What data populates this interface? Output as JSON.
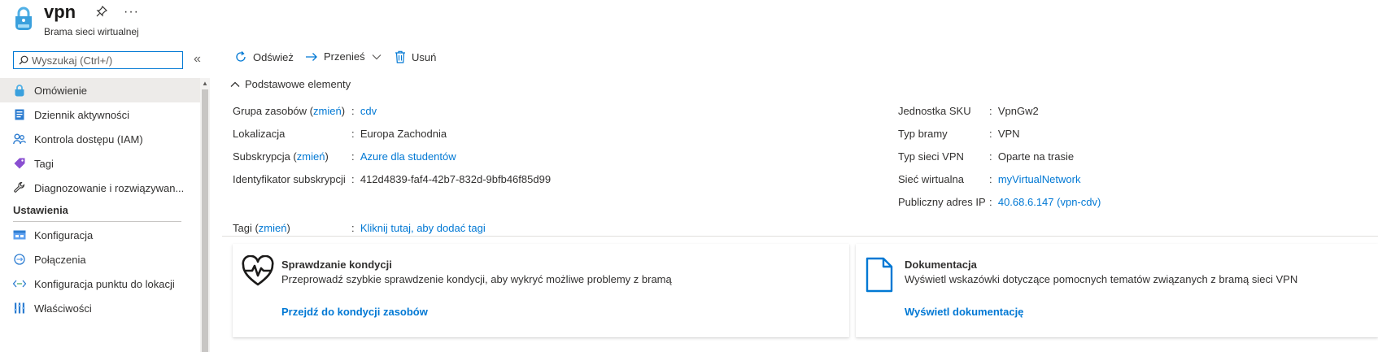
{
  "header": {
    "title": "vpn",
    "subtitle": "Brama sieci wirtualnej"
  },
  "sidebar": {
    "search_placeholder": "Wyszukaj (Ctrl+/)",
    "items": [
      {
        "label": "Omówienie",
        "icon": "vpn-lock-icon"
      },
      {
        "label": "Dziennik aktywności",
        "icon": "activity-log-icon"
      },
      {
        "label": "Kontrola dostępu (IAM)",
        "icon": "people-icon"
      },
      {
        "label": "Tagi",
        "icon": "tag-icon"
      },
      {
        "label": "Diagnozowanie i rozwiązywan...",
        "icon": "wrench-icon"
      }
    ],
    "settings_header": "Ustawienia",
    "settings_items": [
      {
        "label": "Konfiguracja",
        "icon": "config-icon"
      },
      {
        "label": "Połączenia",
        "icon": "connections-icon"
      },
      {
        "label": "Konfiguracja punktu do lokacji",
        "icon": "p2s-icon"
      },
      {
        "label": "Właściwości",
        "icon": "properties-icon"
      }
    ]
  },
  "toolbar": {
    "refresh": "Odśwież",
    "move": "Przenieś",
    "delete": "Usuń"
  },
  "essentials": {
    "header": "Podstawowe elementy",
    "change": "zmień",
    "left": [
      {
        "label_pre": "Grupa zasobów (",
        "label_post": ")",
        "value": "cdv",
        "value_link": true,
        "has_change": true
      },
      {
        "label_pre": "Lokalizacja",
        "label_post": "",
        "value": "Europa Zachodnia",
        "value_link": false,
        "has_change": false
      },
      {
        "label_pre": "Subskrypcja (",
        "label_post": ")",
        "value": "Azure dla studentów",
        "value_link": true,
        "has_change": true
      },
      {
        "label_pre": "Identyfikator subskrypcji",
        "label_post": "",
        "value": "412d4839-faf4-42b7-832d-9bfb46f85d99",
        "value_link": false,
        "has_change": false
      }
    ],
    "right": [
      {
        "label": "Jednostka SKU",
        "value": "VpnGw2",
        "value_link": false
      },
      {
        "label": "Typ bramy",
        "value": "VPN",
        "value_link": false
      },
      {
        "label": "Typ sieci VPN",
        "value": "Oparte na trasie",
        "value_link": false
      },
      {
        "label": "Sieć wirtualna",
        "value": "myVirtualNetwork",
        "value_link": true
      },
      {
        "label": "Publiczny adres IP",
        "value": "40.68.6.147 (vpn-cdv)",
        "value_link": true
      }
    ],
    "tags": {
      "label_pre": "Tagi (",
      "label_post": ")",
      "value": "Kliknij tutaj, aby dodać tagi"
    }
  },
  "cards": [
    {
      "title": "Sprawdzanie kondycji",
      "desc": "Przeprowadź szybkie sprawdzenie kondycji, aby wykryć możliwe problemy z bramą",
      "link": "Przejdź do kondycji zasobów",
      "icon": "heart-pulse-icon"
    },
    {
      "title": "Dokumentacja",
      "desc": "Wyświetl wskazówki dotyczące pomocnych tematów związanych z bramą sieci VPN",
      "link": "Wyświetl dokumentację",
      "icon": "document-icon"
    }
  ],
  "colors": {
    "accent": "#0078d4",
    "selected_bg": "#edebe9"
  }
}
